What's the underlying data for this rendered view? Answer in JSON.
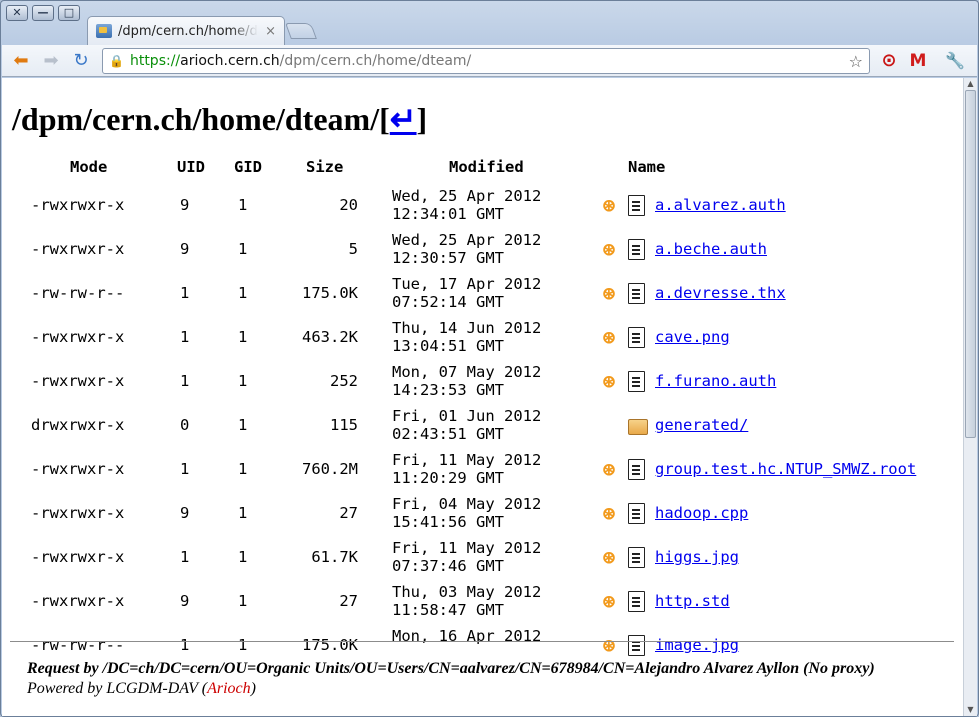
{
  "window": {
    "close": "✕",
    "minimize": "—",
    "maximize": "□"
  },
  "tab": {
    "title": "/dpm/cern.ch/home/dteam/",
    "close": "×"
  },
  "address": {
    "protocol": "https://",
    "host": "arioch.cern.ch",
    "path": "/dpm/cern.ch/home/dteam/"
  },
  "page": {
    "heading": "/dpm/cern.ch/home/dteam/[",
    "return_glyph": "↵",
    "heading_end": "]"
  },
  "headers": {
    "mode": "Mode",
    "uid": "UID",
    "gid": "GID",
    "size": "Size",
    "modified": "Modified",
    "name": "Name"
  },
  "files": [
    {
      "mode": "-rwxrwxr-x",
      "uid": "9",
      "gid": "1",
      "size": "20",
      "date": "Wed, 25 Apr 2012",
      "time": "12:34:01 GMT",
      "name": "a.alvarez.auth",
      "type": "file"
    },
    {
      "mode": "-rwxrwxr-x",
      "uid": "9",
      "gid": "1",
      "size": "5",
      "date": "Wed, 25 Apr 2012",
      "time": "12:30:57 GMT",
      "name": "a.beche.auth",
      "type": "file"
    },
    {
      "mode": "-rw-rw-r--",
      "uid": "1",
      "gid": "1",
      "size": "175.0K",
      "date": "Tue, 17 Apr 2012",
      "time": "07:52:14 GMT",
      "name": "a.devresse.thx",
      "type": "file"
    },
    {
      "mode": "-rwxrwxr-x",
      "uid": "1",
      "gid": "1",
      "size": "463.2K",
      "date": "Thu, 14 Jun 2012",
      "time": "13:04:51 GMT",
      "name": "cave.png",
      "type": "file"
    },
    {
      "mode": "-rwxrwxr-x",
      "uid": "1",
      "gid": "1",
      "size": "252",
      "date": "Mon, 07 May 2012",
      "time": "14:23:53 GMT",
      "name": "f.furano.auth",
      "type": "file"
    },
    {
      "mode": "drwxrwxr-x",
      "uid": "0",
      "gid": "1",
      "size": "115",
      "date": "Fri, 01 Jun 2012",
      "time": "02:43:51 GMT",
      "name": "generated/",
      "type": "folder"
    },
    {
      "mode": "-rwxrwxr-x",
      "uid": "1",
      "gid": "1",
      "size": "760.2M",
      "date": "Fri, 11 May 2012",
      "time": "11:20:29 GMT",
      "name": "group.test.hc.NTUP_SMWZ.root",
      "type": "file"
    },
    {
      "mode": "-rwxrwxr-x",
      "uid": "9",
      "gid": "1",
      "size": "27",
      "date": "Fri, 04 May 2012",
      "time": "15:41:56 GMT",
      "name": "hadoop.cpp",
      "type": "file"
    },
    {
      "mode": "-rwxrwxr-x",
      "uid": "1",
      "gid": "1",
      "size": "61.7K",
      "date": "Fri, 11 May 2012",
      "time": "07:37:46 GMT",
      "name": "higgs.jpg",
      "type": "file"
    },
    {
      "mode": "-rwxrwxr-x",
      "uid": "9",
      "gid": "1",
      "size": "27",
      "date": "Thu, 03 May 2012",
      "time": "11:58:47 GMT",
      "name": "http.std",
      "type": "file"
    },
    {
      "mode": "-rw-rw-r--",
      "uid": "1",
      "gid": "1",
      "size": "175.0K",
      "date": "Mon, 16 Apr 2012",
      "time": "",
      "name": "image.jpg",
      "type": "file"
    }
  ],
  "footer": {
    "request": "Request by /DC=ch/DC=cern/OU=Organic Units/OU=Users/CN=aalvarez/CN=678984/CN=Alejandro Alvarez Ayllon (No proxy)",
    "powered_prefix": "Powered by LCGDM-DAV (",
    "powered_host": "Arioch",
    "powered_suffix": ")"
  },
  "icons": {
    "link": "link-icon",
    "file": "file-icon",
    "folder": "folder-icon"
  },
  "colors": {
    "link": "#0000ee",
    "link_icon": "#f29a1c",
    "chrome_frame": "#b9cbe3"
  }
}
